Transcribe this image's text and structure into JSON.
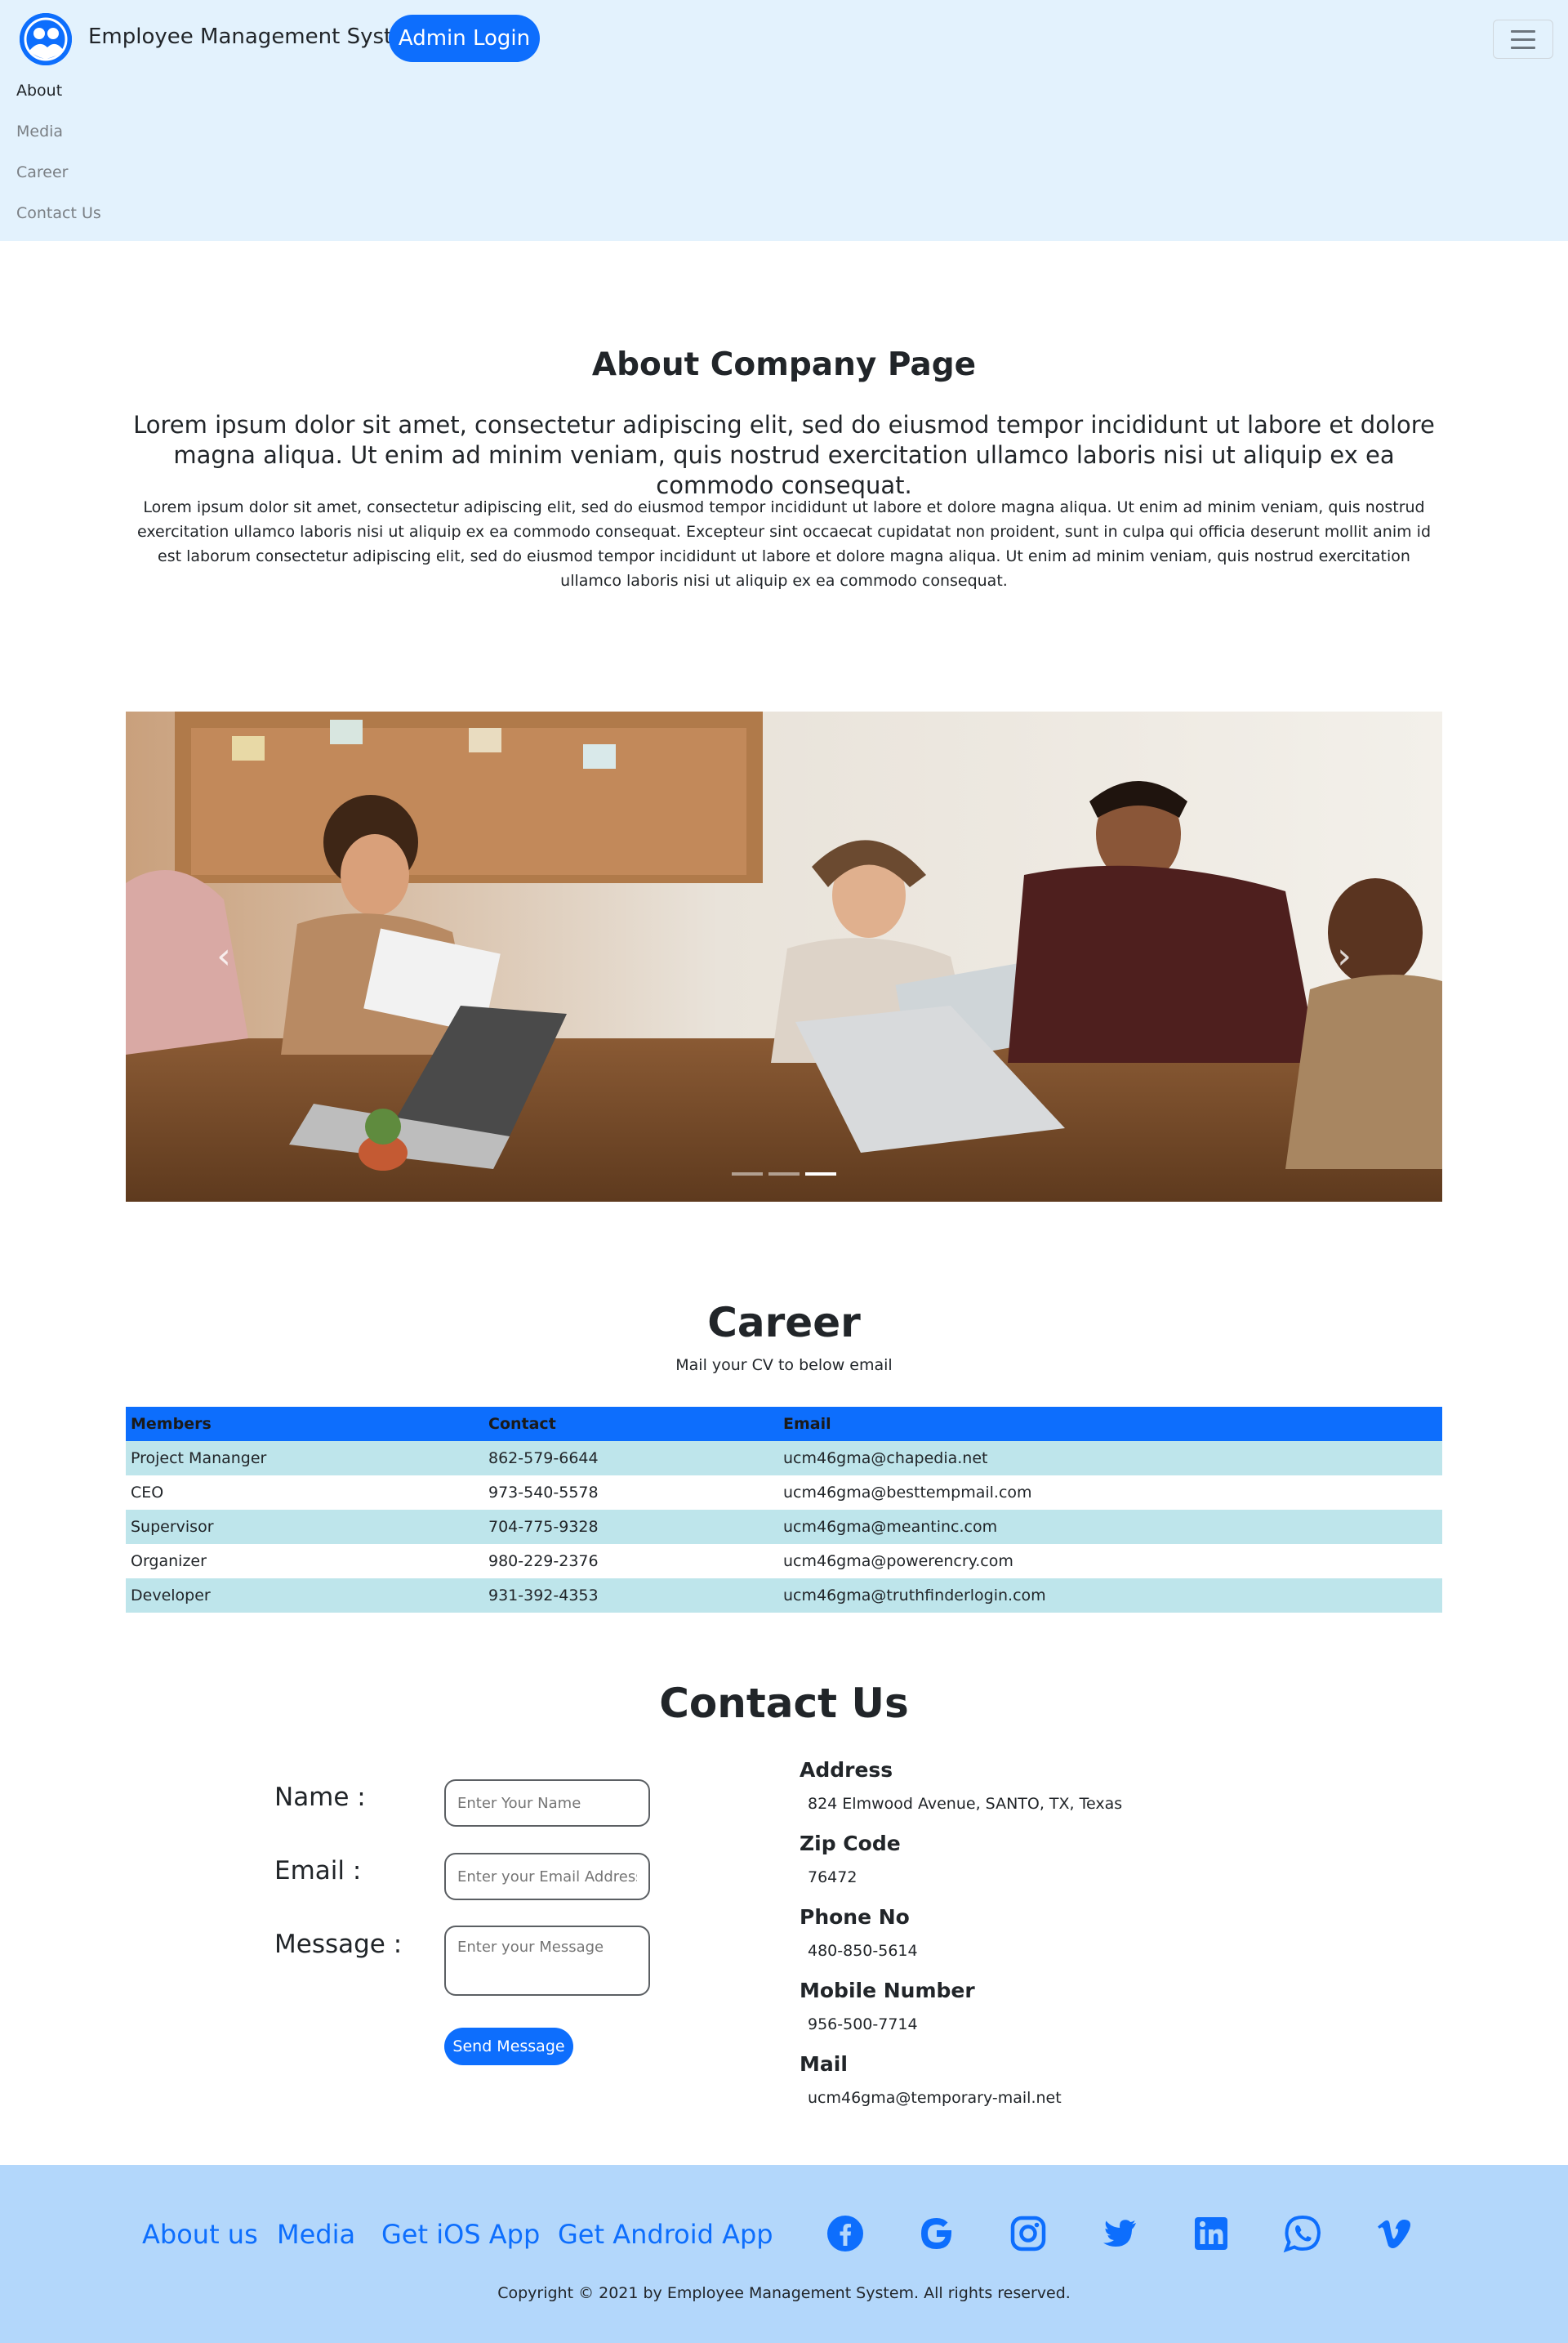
{
  "navbar": {
    "brand": "Employee Management System",
    "admin_button": "Admin Login",
    "links": [
      "About",
      "Media",
      "Career",
      "Contact Us"
    ],
    "active_link": "About",
    "background": "#e3f2fd"
  },
  "about": {
    "title": "About Company Page",
    "lead": "Lorem ipsum dolor sit amet, consectetur adipiscing elit, sed do eiusmod tempor incididunt ut labore et dolore magna aliqua. Ut enim ad minim veniam, quis nostrud exercitation ullamco laboris nisi ut aliquip ex ea commodo consequat.",
    "body": "Lorem ipsum dolor sit amet, consectetur adipiscing elit, sed do eiusmod tempor incididunt ut labore et dolore magna aliqua. Ut enim ad minim veniam, quis nostrud exercitation ullamco laboris nisi ut aliquip ex ea commodo consequat. Excepteur sint occaecat cupidatat non proident, sunt in culpa qui officia deserunt mollit anim id est laborum consectetur adipiscing elit, sed do eiusmod tempor incididunt ut labore et dolore magna aliqua. Ut enim ad minim veniam, quis nostrud exercitation ullamco laboris nisi ut aliquip ex ea commodo consequat."
  },
  "carousel": {
    "slide_count": 3,
    "active_slide": 3,
    "prev_icon": "chevron-left-icon",
    "next_icon": "chevron-right-icon"
  },
  "career": {
    "title": "Career",
    "subtitle": "Mail your CV to below email",
    "columns": [
      "Members",
      "Contact",
      "Email"
    ],
    "rows": [
      [
        "Project Mananger",
        "862-579-6644",
        "ucm46gma@chapedia.net"
      ],
      [
        "CEO",
        "973-540-5578",
        "ucm46gma@besttempmail.com"
      ],
      [
        "Supervisor",
        "704-775-9328",
        "ucm46gma@meantinc.com"
      ],
      [
        "Organizer",
        "980-229-2376",
        "ucm46gma@powerencry.com"
      ],
      [
        "Developer",
        "931-392-4353",
        "ucm46gma@truthfinderlogin.com"
      ]
    ],
    "header_color": "#0d6efd",
    "stripe_color": "#bee5eb"
  },
  "contact": {
    "title": "Contact Us",
    "form": {
      "name_label": "Name :",
      "name_placeholder": "Enter Your Name",
      "email_label": "Email :",
      "email_placeholder": "Enter your Email Address",
      "message_label": "Message :",
      "message_placeholder": "Enter your Message",
      "submit": "Send Message"
    },
    "info": [
      {
        "label": "Address",
        "value": "824 Elmwood Avenue, SANTO, TX, Texas"
      },
      {
        "label": "Zip Code",
        "value": "76472"
      },
      {
        "label": "Phone No",
        "value": "480-850-5614"
      },
      {
        "label": "Mobile Number",
        "value": "956-500-7714"
      },
      {
        "label": "Mail",
        "value": "ucm46gma@temporary-mail.net"
      }
    ]
  },
  "footer": {
    "links": [
      "About us",
      "Media",
      "Get iOS App",
      "Get Android App"
    ],
    "social_icons": [
      "facebook-icon",
      "google-icon",
      "instagram-icon",
      "twitter-icon",
      "linkedin-icon",
      "whatsapp-icon",
      "vimeo-icon"
    ],
    "copyright": "Copyright © 2021 by Employee Management System. All rights reserved.",
    "background": "#b3d7fb",
    "link_color": "#0d6efd"
  }
}
